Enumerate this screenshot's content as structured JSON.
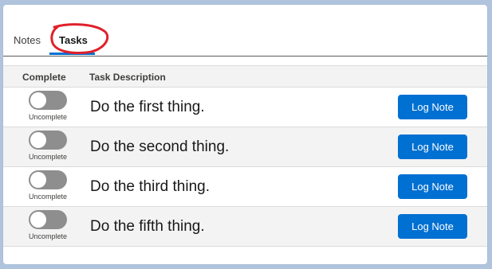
{
  "tabs": [
    {
      "label": "Notes",
      "active": false
    },
    {
      "label": "Tasks",
      "active": true
    }
  ],
  "table": {
    "headers": {
      "complete": "Complete",
      "description": "Task Description"
    },
    "rows": [
      {
        "status": "Uncomplete",
        "description": "Do the first thing.",
        "button": "Log Note"
      },
      {
        "status": "Uncomplete",
        "description": "Do the second thing.",
        "button": "Log Note"
      },
      {
        "status": "Uncomplete",
        "description": "Do the third thing.",
        "button": "Log Note"
      },
      {
        "status": "Uncomplete",
        "description": "Do the fifth thing.",
        "button": "Log Note"
      }
    ]
  },
  "colors": {
    "accent": "#0070d2",
    "annotation": "#e0202a",
    "toggle_off": "#8e8e8e"
  }
}
